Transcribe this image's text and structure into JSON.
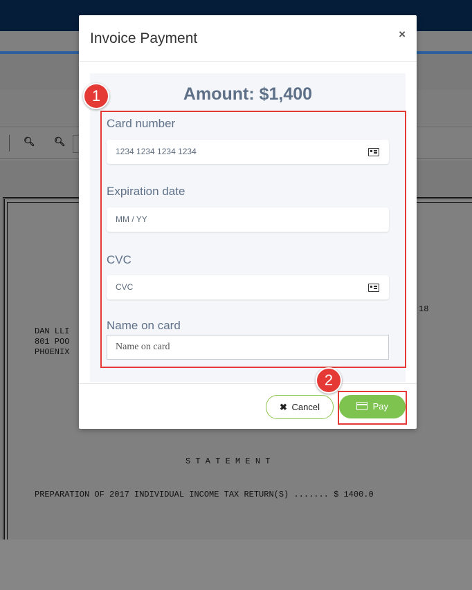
{
  "modal": {
    "title": "Invoice Payment",
    "close_glyph": "×",
    "amount": "Amount: $1,400",
    "fields": {
      "card_number": {
        "label": "Card number",
        "placeholder": "1234 1234 1234 1234",
        "icon": "card-icon"
      },
      "expiration": {
        "label": "Expiration date",
        "placeholder": "MM / YY"
      },
      "cvc": {
        "label": "CVC",
        "placeholder": "CVC",
        "icon": "cvc-card-icon"
      },
      "name": {
        "label": "Name on card",
        "placeholder": "Name on card"
      }
    },
    "buttons": {
      "cancel_icon": "✖",
      "cancel_label": "Cancel",
      "pay_label": "Pay"
    }
  },
  "annotations": {
    "step1": "1",
    "step2": "2",
    "highlight_color": "#e53935"
  },
  "document": {
    "toolbar_icons": [
      "zoom-out-icon",
      "zoom-in-icon"
    ],
    "addr_line1": "DAN LLI",
    "addr_line2": "801 POO",
    "addr_line3": "PHOENIX",
    "date_fragment": "18",
    "statement_heading": "S T A T E M E N T",
    "statement_line": "PREPARATION OF 2017 INDIVIDUAL INCOME TAX RETURN(S) ....... $ 1400.0"
  },
  "colors": {
    "pay_button": "#7ec34f",
    "amount_text": "#5e7088",
    "top_bar": "#061d3a"
  }
}
